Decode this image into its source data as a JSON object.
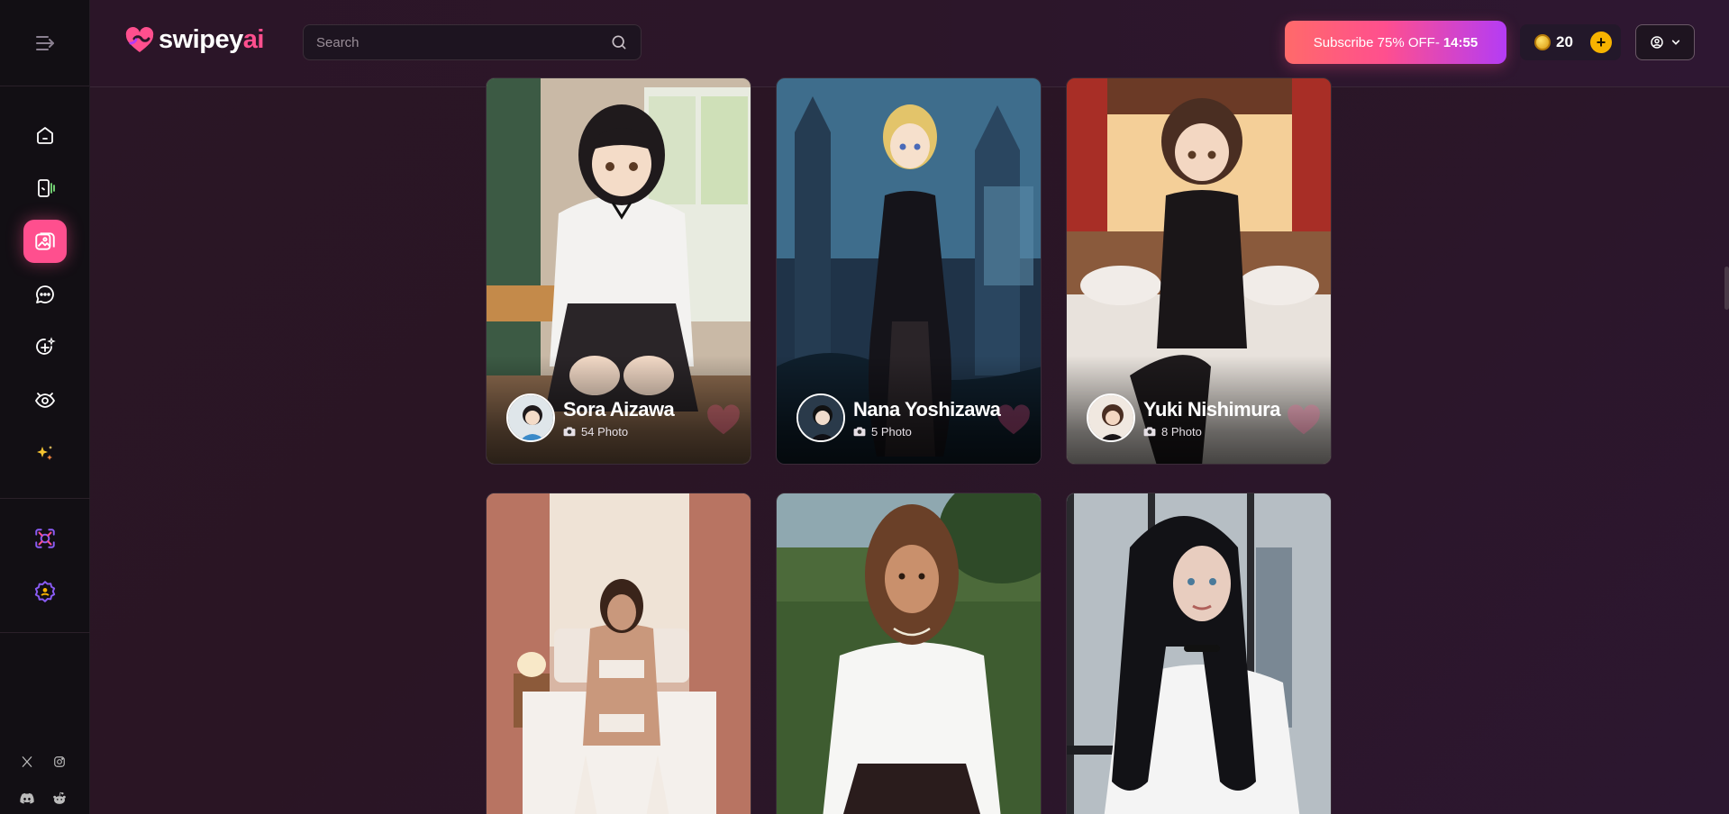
{
  "brand": {
    "part1": "swipey",
    "part2": "ai"
  },
  "search": {
    "placeholder": "Search"
  },
  "subscribe": {
    "label": "Subscribe 75% OFF-",
    "timer": "14:55"
  },
  "coins": {
    "value": "20",
    "add_label": "+"
  },
  "sidebar": {
    "items": [
      {
        "icon": "home-icon"
      },
      {
        "icon": "swipe-cards-icon"
      },
      {
        "icon": "gallery-icon",
        "active": true
      },
      {
        "icon": "chat-icon"
      },
      {
        "icon": "create-character-icon"
      },
      {
        "icon": "eye-icon"
      },
      {
        "icon": "sparkles-icon"
      }
    ],
    "extra": [
      {
        "icon": "face-scan-icon"
      },
      {
        "icon": "premium-badge-icon"
      }
    ],
    "social": [
      "x-icon",
      "instagram-icon",
      "discord-icon",
      "reddit-icon"
    ]
  },
  "cards": [
    {
      "name": "Sora Aizawa",
      "photos": "54 Photo"
    },
    {
      "name": "Nana Yoshizawa",
      "photos": "5 Photo"
    },
    {
      "name": "Yuki Nishimura",
      "photos": "8 Photo"
    },
    {
      "name": "",
      "photos": ""
    },
    {
      "name": "",
      "photos": ""
    },
    {
      "name": "",
      "photos": ""
    }
  ],
  "colors": {
    "accent": "#ff4f8e",
    "accent_purple": "#b43cf5",
    "sidebar_bg": "#120f14",
    "page_bg": "#2a1626",
    "coin": "#f7b300"
  }
}
